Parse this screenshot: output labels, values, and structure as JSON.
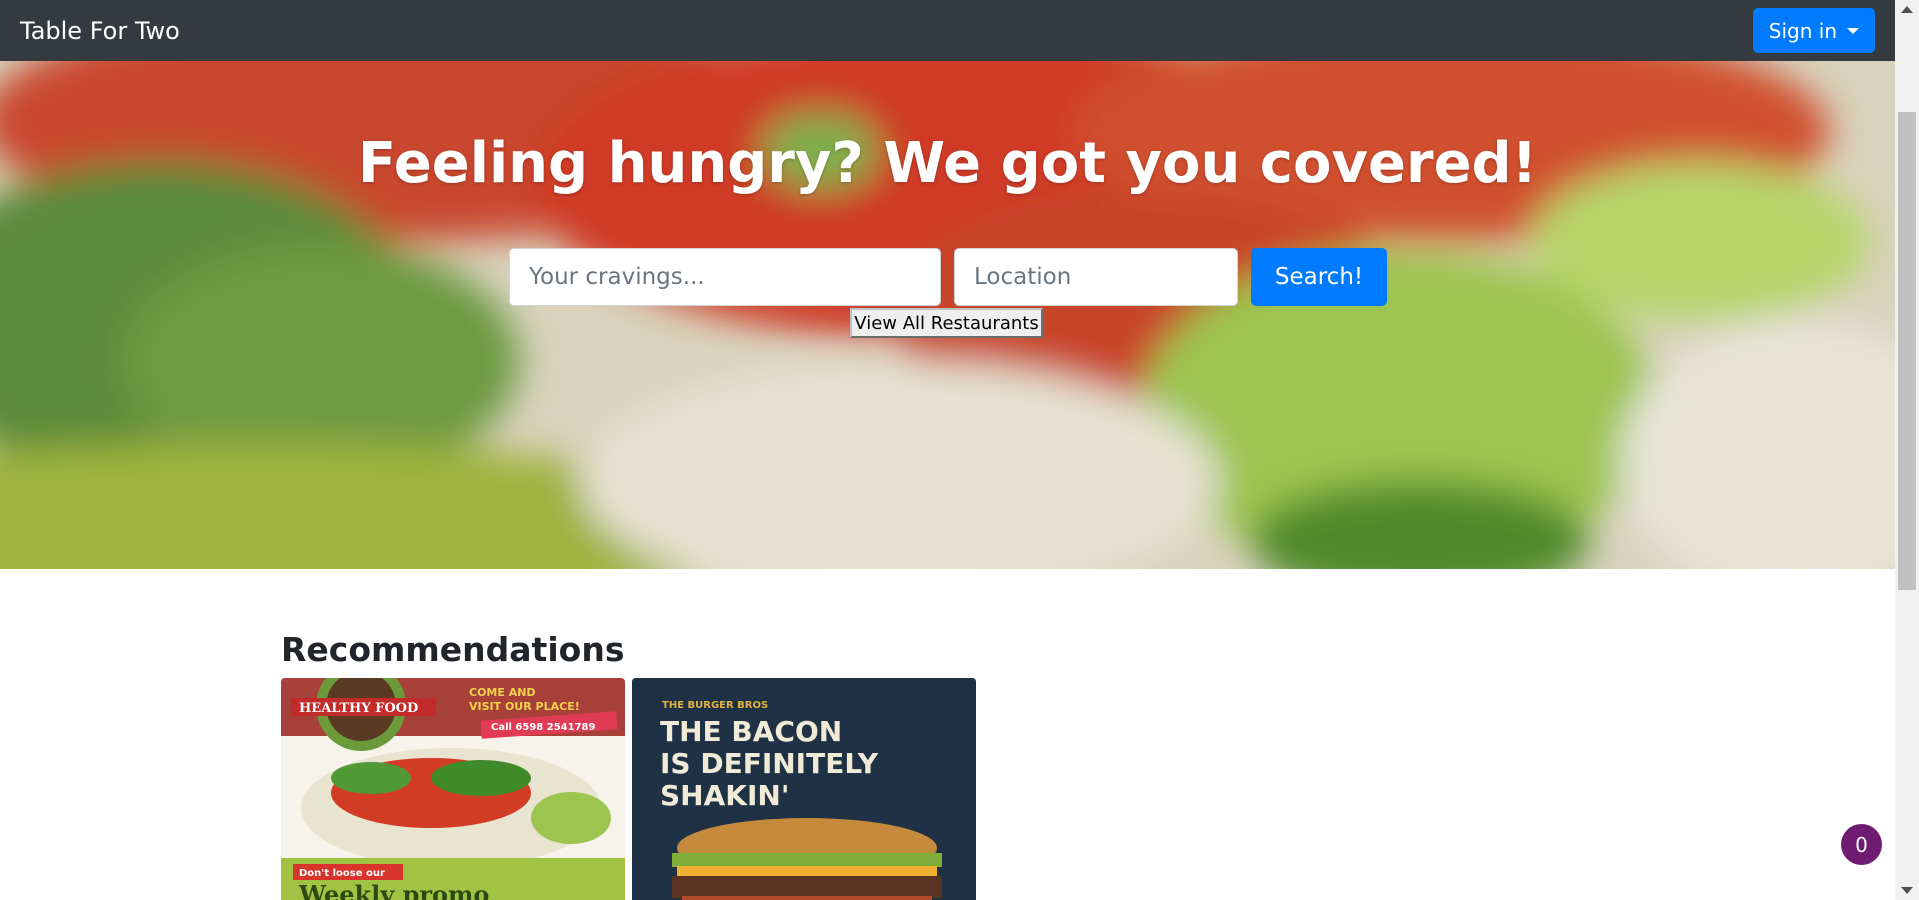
{
  "navbar": {
    "brand": "Table For Two",
    "signin_label": "Sign in"
  },
  "hero": {
    "title": "Feeling hungry? We got you covered!",
    "cravings_placeholder": "Your cravings...",
    "location_placeholder": "Location",
    "search_label": "Search!",
    "view_all_label": "View All Restaurants"
  },
  "recommendations": {
    "title": "Recommendations",
    "cards": [
      {
        "name": "healthy-food-poster",
        "badge": "HEALTHY FOOD",
        "tagline": "COME AND VISIT OUR PLACE!",
        "phone": "Call 6598 2541789",
        "note": "Don't loose our",
        "promo": "Weekly promo"
      },
      {
        "name": "burger-bros-poster",
        "brand": "THE BURGER BROS",
        "headline_1": "THE BACON",
        "headline_2": "IS DEFINITELY",
        "headline_3": "SHAKIN'"
      }
    ]
  },
  "notification_count": "0",
  "colors": {
    "navbar": "#343a40",
    "primary": "#007bff",
    "badge": "#6f1b72"
  }
}
